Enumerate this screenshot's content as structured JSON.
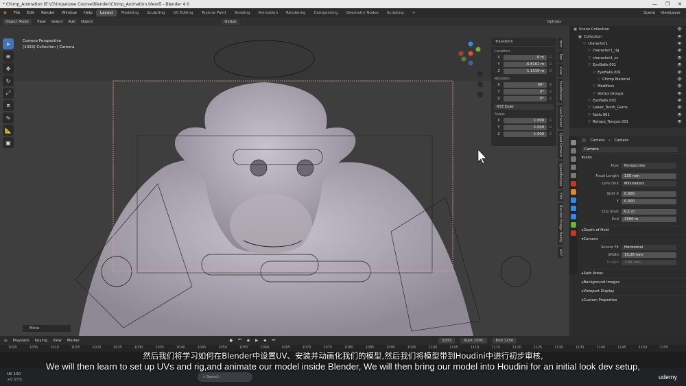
{
  "window": {
    "title": "* Chimp_Animation [E:\\Chimpanzee Course\\Blender\\Chimp_Animation.blend] - Blender 4.0",
    "controls": [
      "—",
      "❐",
      "✕"
    ]
  },
  "menu": {
    "items": [
      "File",
      "Edit",
      "Render",
      "Window",
      "Help"
    ],
    "workspaces": [
      "Layout",
      "Modeling",
      "Sculpting",
      "UV Editing",
      "Texture Paint",
      "Shading",
      "Animation",
      "Rendering",
      "Compositing",
      "Geometry Nodes",
      "Scripting"
    ],
    "active_workspace": "Layout",
    "scene": "Scene",
    "view_layer": "ViewLayer"
  },
  "viewport_header": {
    "mode": "Object Mode",
    "items": [
      "View",
      "Select",
      "Add",
      "Object"
    ],
    "orientation": "Global",
    "options": "Options"
  },
  "viewport": {
    "info_line1": "Camera Perspective",
    "info_line2": "(1033) Collection | Camera",
    "last_op": "Move"
  },
  "transform": {
    "title": "Transform",
    "location_label": "Location:",
    "location": [
      {
        "axis": "X",
        "value": "0 m"
      },
      {
        "axis": "Y",
        "value": "-6.8161 m"
      },
      {
        "axis": "Z",
        "value": "1.1319 m"
      }
    ],
    "rotation_label": "Rotation:",
    "rotation": [
      {
        "axis": "X",
        "value": "90°"
      },
      {
        "axis": "Y",
        "value": "0°"
      },
      {
        "axis": "Z",
        "value": "0°"
      }
    ],
    "rotation_mode": "XYZ Euler",
    "scale_label": "Scale:",
    "scale": [
      {
        "axis": "X",
        "value": "1.000"
      },
      {
        "axis": "Y",
        "value": "1.000"
      },
      {
        "axis": "Z",
        "value": "1.000"
      }
    ]
  },
  "side_tabs": [
    "Item",
    "Tool",
    "View",
    "FaceBuilder",
    "Geo-Tracker",
    "Quad Remesh",
    "SpeedRetopo",
    "Edit",
    "Blender Bridge Buddy",
    "ARP"
  ],
  "outliner": {
    "rows": [
      {
        "label": "Scene Collection",
        "indent": 0
      },
      {
        "label": "Collection",
        "indent": 1
      },
      {
        "label": "character1",
        "indent": 2
      },
      {
        "label": "character1_rig",
        "indent": 3
      },
      {
        "label": "character1_cs",
        "indent": 3
      },
      {
        "label": "EyeBalls.001",
        "indent": 3
      },
      {
        "label": "EyeBalls.001",
        "indent": 4
      },
      {
        "label": "Chimp Material",
        "indent": 5
      },
      {
        "label": "Modifiers",
        "indent": 4
      },
      {
        "label": "Vertex Groups",
        "indent": 4
      },
      {
        "label": "EyeBalls.002",
        "indent": 3
      },
      {
        "label": "Lower_Teeth_Gums",
        "indent": 3
      },
      {
        "label": "Nails.001",
        "indent": 3
      },
      {
        "label": "Retopo_Tongue.001",
        "indent": 3
      }
    ]
  },
  "properties": {
    "breadcrumb_obj": "Camera",
    "breadcrumb_data": "Camera",
    "datablock": "Camera",
    "lens_section": "Lens",
    "type_label": "Type",
    "type_value": "Perspective",
    "focal_label": "Focal Length",
    "focal_value": "135 mm",
    "lens_unit_label": "Lens Unit",
    "lens_unit_value": "Millimeters",
    "shift_x_label": "Shift X",
    "shift_x_value": "0.000",
    "shift_y_label": "Y",
    "shift_y_value": "0.000",
    "clip_start_label": "Clip Start",
    "clip_start_value": "0.1 m",
    "clip_end_label": "End",
    "clip_end_value": "1000 m",
    "dof_section": "Depth of Field",
    "camera_section": "Camera",
    "sensor_fit_label": "Sensor Fit",
    "sensor_fit_value": "Horizontal",
    "width_label": "Width",
    "width_value": "10.26 mm",
    "height_label": "Height",
    "height_value": "7.49 mm",
    "safe_areas": "Safe Areas",
    "background_images": "Background Images",
    "viewport_display": "Viewport Display",
    "custom_properties": "Custom Properties"
  },
  "timeline": {
    "menu": [
      "Playback",
      "Keying",
      "View",
      "Marker"
    ],
    "current_frame": "1033",
    "start_label": "Start",
    "start": "1001",
    "end_label": "End",
    "end": "1250",
    "ticks": [
      "1000",
      "1005",
      "1010",
      "1015",
      "1020",
      "1025",
      "1030",
      "1035",
      "1040",
      "1045",
      "1050",
      "1055",
      "1060",
      "1065",
      "1070",
      "1075",
      "1080",
      "1085",
      "1090",
      "1095",
      "1100",
      "1105",
      "1110",
      "1115",
      "1120",
      "1125",
      "1130",
      "1135",
      "1140",
      "1145",
      "1150",
      "1155"
    ]
  },
  "subtitles": {
    "cn": "然后我们将学习如何在Blender中设置UV、安装并动画化我们的模型,然后我们将模型带到Houdini中进行初步审核,",
    "en": "We will then learn to set up UVs and rig,and animate our model inside Blender, We will then bring our model into Houdini for an initial look dev setup,"
  },
  "taskbar": {
    "ticker": "UK 100",
    "ticker_change": "+0.55%",
    "search": "Search",
    "status": "Select"
  },
  "brand": "udemy",
  "colors": {
    "accent": "#4772b3",
    "selection": "#334d80",
    "camera_frame": "#e2a0a0"
  }
}
